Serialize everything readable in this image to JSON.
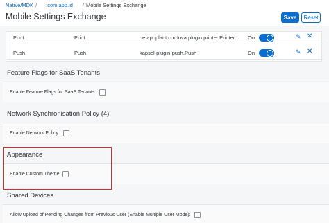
{
  "breadcrumb": {
    "items": [
      "Native/MDK",
      "com.app.id",
      "Mobile Settings Exchange"
    ],
    "separator": "/"
  },
  "header": {
    "title": "Mobile Settings Exchange",
    "save_label": "Save",
    "reset_label": "Reset"
  },
  "plugins": {
    "rows": [
      {
        "col1": "Print",
        "col2": "Print",
        "col3": "de.appplant.cordova.plugin.printer.Printer",
        "status": "On",
        "enabled": true
      },
      {
        "col1": "Push",
        "col2": "Push",
        "col3": "kapsel-plugin-push.Push",
        "status": "On",
        "enabled": true
      }
    ]
  },
  "sections": {
    "feature_flags": {
      "title": "Feature Flags for SaaS Tenants",
      "field_label": "Enable Feature Flags for SaaS Tenants:",
      "checked": false
    },
    "network_sync": {
      "title": "Network Synchronisation Policy (4)",
      "field_label": "Enable Network Policy:",
      "checked": false
    },
    "appearance": {
      "title": "Appearance",
      "field_label": "Enable Custom Theme",
      "checked": false
    },
    "shared_devices": {
      "title": "Shared Devices",
      "field_label": "Allow Upload of Pending Changes from Previous User (Enable Multiple User Mode):",
      "checked": false
    }
  },
  "colors": {
    "accent": "#0a6ed1",
    "highlight": "#e0242b"
  },
  "icons": {
    "edit": "pencil-icon",
    "delete": "close-icon"
  }
}
